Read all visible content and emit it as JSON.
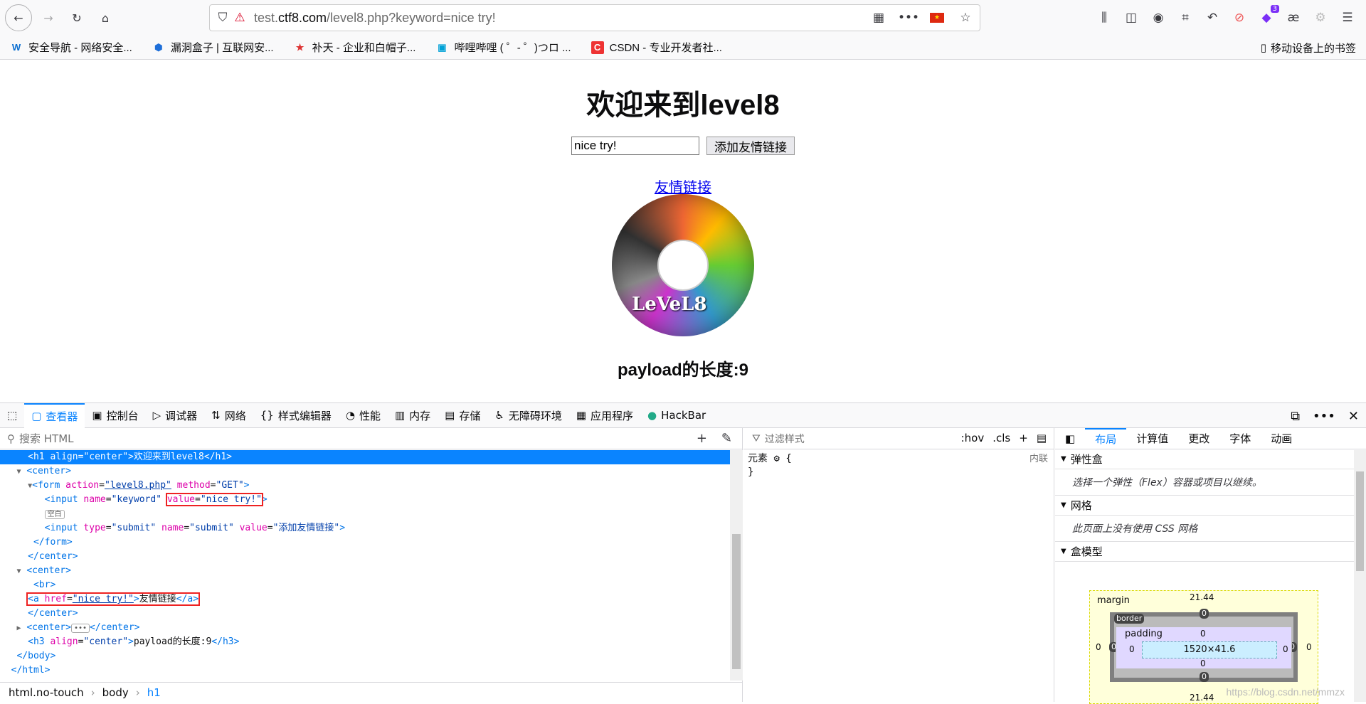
{
  "browser": {
    "url_prefix": "test.",
    "url_domain": "ctf8.com",
    "url_path": "/level8.php?keyword=nice try!",
    "extension_badge": "3",
    "ae_icon": "æ"
  },
  "bookmarks": [
    {
      "icon": "W",
      "label": "安全导航 - 网络安全..."
    },
    {
      "icon": "⬢",
      "label": "漏洞盒子 | 互联网安..."
    },
    {
      "icon": "★",
      "label": "补天 - 企业和白帽子..."
    },
    {
      "icon": "▣",
      "label": "哔哩哔哩 ( ゜- ゜)つロ ..."
    },
    {
      "icon": "C",
      "label": "CSDN - 专业开发者社..."
    }
  ],
  "mobile_bookmarks": "移动设备上的书签",
  "page": {
    "title": "欢迎来到level8",
    "input_value": "nice try!",
    "submit_label": "添加友情链接",
    "link_text": "友情链接",
    "disc_label": "LeVeL8",
    "payload_length": "payload的长度:9"
  },
  "devtools": {
    "tabs": [
      "查看器",
      "控制台",
      "调试器",
      "网络",
      "样式编辑器",
      "性能",
      "内存",
      "存储",
      "无障碍环境",
      "应用程序",
      "HackBar"
    ],
    "search_placeholder": "搜索 HTML",
    "filter_placeholder": "过滤样式",
    "hov": ":hov",
    "cls": ".cls",
    "rule_selector": "元素",
    "rule_open": "{",
    "rule_close": "}",
    "rule_source": "内联",
    "right_tabs": [
      "布局",
      "计算值",
      "更改",
      "字体",
      "动画"
    ],
    "sections": {
      "flex": "弹性盒",
      "flex_msg": "选择一个弹性（Flex）容器或项目以继续。",
      "grid": "网格",
      "grid_msg": "此页面上没有使用 CSS 网格",
      "box": "盒模型"
    },
    "box_model": {
      "margin_label": "margin",
      "border_label": "border",
      "padding_label": "padding",
      "margin_top": "21.44",
      "margin_bottom": "21.44",
      "margin_side": "0",
      "border_val": "0",
      "padding_val": "0",
      "content": "1520×41.6"
    },
    "breadcrumbs": [
      "html.no-touch",
      "body",
      "h1"
    ],
    "markup": {
      "h1_text": "欢迎来到level8",
      "form_action": "level8.php",
      "form_method": "GET",
      "input_name": "keyword",
      "input_value": "nice try!",
      "whitespace": "空白",
      "submit_type": "submit",
      "submit_name": "submit",
      "submit_value": "添加友情链接",
      "a_href": "nice try!",
      "a_text": "友情链接",
      "h3_text": "payload的长度:9"
    }
  },
  "watermark": "https://blog.csdn.net/mmzx"
}
